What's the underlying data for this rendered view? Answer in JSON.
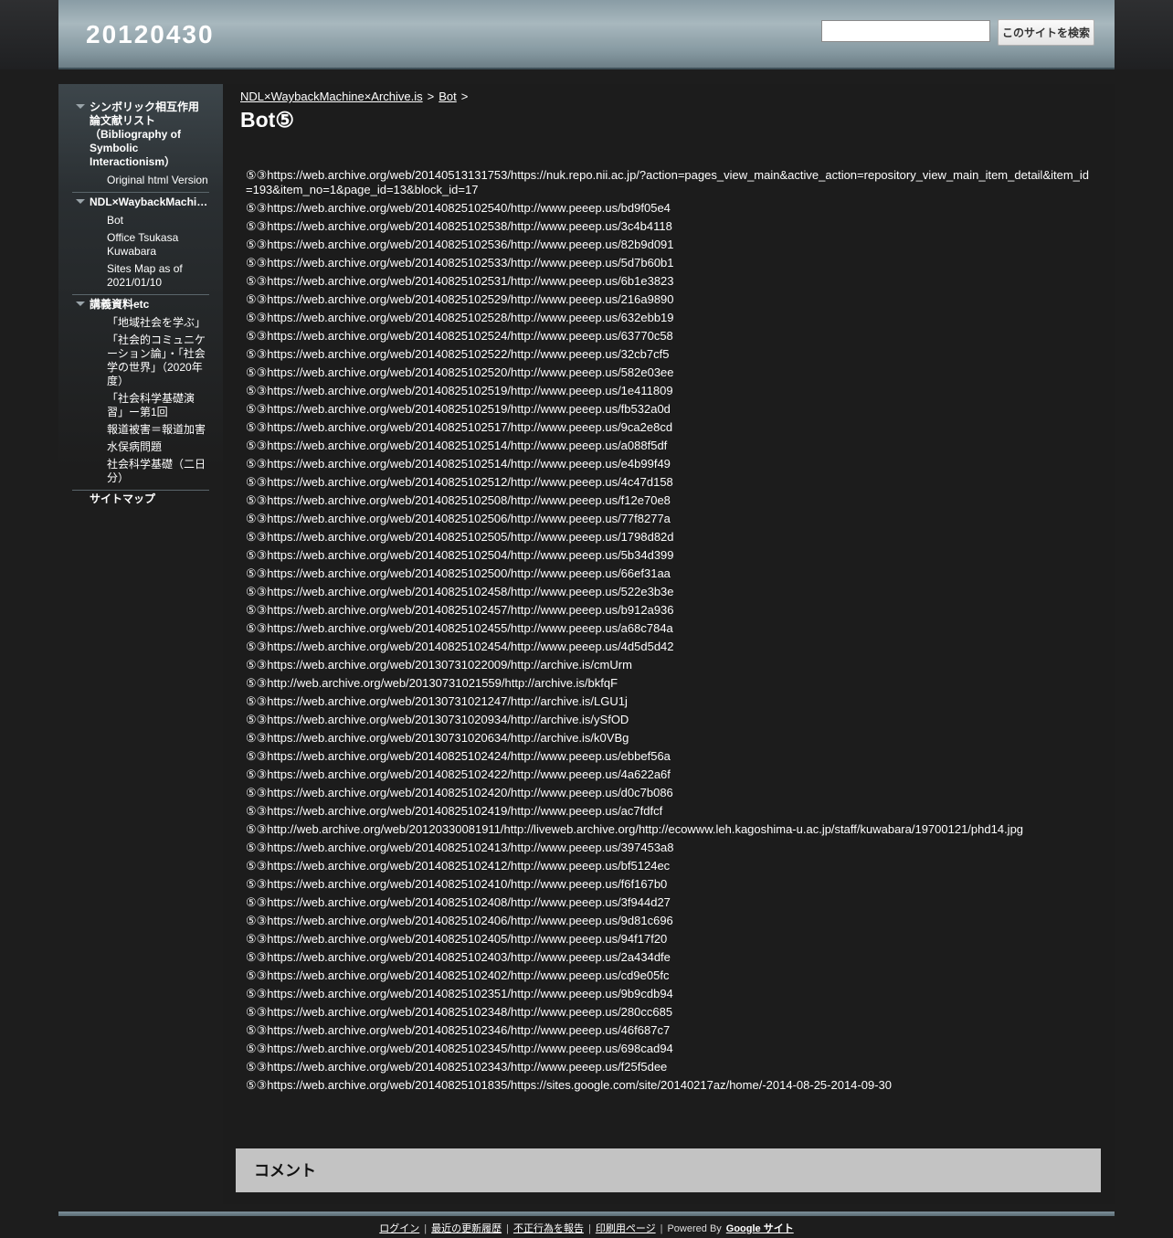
{
  "header": {
    "site_title": "20120430",
    "search_placeholder": "",
    "search_button": "このサイトを検索"
  },
  "sidebar": {
    "groups": [
      {
        "label": "シンボリック相互作用論文献リスト（Bibliography of Symbolic Interactionism）",
        "children": [
          "Original html Version"
        ]
      },
      {
        "label": "NDL×WaybackMachine×Archive.is",
        "children": [
          "Bot",
          "Office Tsukasa Kuwabara",
          "Sites Map as of 2021/01/10"
        ]
      },
      {
        "label": "講義資料etc",
        "children": [
          "「地域社会を学ぶ」",
          "「社会的コミュニケーション論」・「社会学の世界」（2020年度）",
          "「社会科学基礎演習」ー第1回",
          "報道被害＝報道加害",
          "水俣病問題",
          "社会科学基礎（二日分）"
        ]
      }
    ],
    "sitemap": "サイトマップ"
  },
  "breadcrumb": {
    "items": [
      "NDL×WaybackMachine×Archive.is",
      "Bot"
    ],
    "separator": ">"
  },
  "page_title": "Bot⑤",
  "links": [
    "⑤③https://web.archive.org/web/20140513131753/https://nuk.repo.nii.ac.jp/?action=pages_view_main&active_action=repository_view_main_item_detail&item_id=193&item_no=1&page_id=13&block_id=17",
    "⑤③https://web.archive.org/web/20140825102540/http://www.peeep.us/bd9f05e4",
    "⑤③https://web.archive.org/web/20140825102538/http://www.peeep.us/3c4b4118",
    "⑤③https://web.archive.org/web/20140825102536/http://www.peeep.us/82b9d091",
    "⑤③https://web.archive.org/web/20140825102533/http://www.peeep.us/5d7b60b1",
    "⑤③https://web.archive.org/web/20140825102531/http://www.peeep.us/6b1e3823",
    "⑤③https://web.archive.org/web/20140825102529/http://www.peeep.us/216a9890",
    "⑤③https://web.archive.org/web/20140825102528/http://www.peeep.us/632ebb19",
    "⑤③https://web.archive.org/web/20140825102524/http://www.peeep.us/63770c58",
    "⑤③https://web.archive.org/web/20140825102522/http://www.peeep.us/32cb7cf5",
    "⑤③https://web.archive.org/web/20140825102520/http://www.peeep.us/582e03ee",
    "⑤③https://web.archive.org/web/20140825102519/http://www.peeep.us/1e411809",
    "⑤③https://web.archive.org/web/20140825102519/http://www.peeep.us/fb532a0d",
    "⑤③https://web.archive.org/web/20140825102517/http://www.peeep.us/9ca2e8cd",
    "⑤③https://web.archive.org/web/20140825102514/http://www.peeep.us/a088f5df",
    "⑤③https://web.archive.org/web/20140825102514/http://www.peeep.us/e4b99f49",
    "⑤③https://web.archive.org/web/20140825102512/http://www.peeep.us/4c47d158",
    "⑤③https://web.archive.org/web/20140825102508/http://www.peeep.us/f12e70e8",
    "⑤③https://web.archive.org/web/20140825102506/http://www.peeep.us/77f8277a",
    "⑤③https://web.archive.org/web/20140825102505/http://www.peeep.us/1798d82d",
    "⑤③https://web.archive.org/web/20140825102504/http://www.peeep.us/5b34d399",
    "⑤③https://web.archive.org/web/20140825102500/http://www.peeep.us/66ef31aa",
    "⑤③https://web.archive.org/web/20140825102458/http://www.peeep.us/522e3b3e",
    "⑤③https://web.archive.org/web/20140825102457/http://www.peeep.us/b912a936",
    "⑤③https://web.archive.org/web/20140825102455/http://www.peeep.us/a68c784a",
    "⑤③https://web.archive.org/web/20140825102454/http://www.peeep.us/4d5d5d42",
    "⑤③https://web.archive.org/web/20130731022009/http://archive.is/cmUrm",
    "⑤③http://web.archive.org/web/20130731021559/http://archive.is/bkfqF",
    "⑤③https://web.archive.org/web/20130731021247/http://archive.is/LGU1j",
    "⑤③https://web.archive.org/web/20130731020934/http://archive.is/ySfOD",
    "⑤③https://web.archive.org/web/20130731020634/http://archive.is/k0VBg",
    "⑤③https://web.archive.org/web/20140825102424/http://www.peeep.us/ebbef56a",
    "⑤③https://web.archive.org/web/20140825102422/http://www.peeep.us/4a622a6f",
    "⑤③https://web.archive.org/web/20140825102420/http://www.peeep.us/d0c7b086",
    "⑤③https://web.archive.org/web/20140825102419/http://www.peeep.us/ac7fdfcf",
    "⑤③http://web.archive.org/web/20120330081911/http://liveweb.archive.org/http://ecowww.leh.kagoshima-u.ac.jp/staff/kuwabara/19700121/phd14.jpg",
    "⑤③https://web.archive.org/web/20140825102413/http://www.peeep.us/397453a8",
    "⑤③https://web.archive.org/web/20140825102412/http://www.peeep.us/bf5124ec",
    "⑤③https://web.archive.org/web/20140825102410/http://www.peeep.us/f6f167b0",
    "⑤③https://web.archive.org/web/20140825102408/http://www.peeep.us/3f944d27",
    "⑤③https://web.archive.org/web/20140825102406/http://www.peeep.us/9d81c696",
    "⑤③https://web.archive.org/web/20140825102405/http://www.peeep.us/94f17f20",
    "⑤③https://web.archive.org/web/20140825102403/http://www.peeep.us/2a434dfe",
    "⑤③https://web.archive.org/web/20140825102402/http://www.peeep.us/cd9e05fc",
    "⑤③https://web.archive.org/web/20140825102351/http://www.peeep.us/9b9cdb94",
    "⑤③https://web.archive.org/web/20140825102348/http://www.peeep.us/280cc685",
    "⑤③https://web.archive.org/web/20140825102346/http://www.peeep.us/46f687c7",
    "⑤③https://web.archive.org/web/20140825102345/http://www.peeep.us/698cad94",
    "⑤③https://web.archive.org/web/20140825102343/http://www.peeep.us/f25f5dee",
    "⑤③https://web.archive.org/web/20140825101835/https://sites.google.com/site/20140217az/home/-2014-08-25-2014-09-30"
  ],
  "comments": {
    "title": "コメント"
  },
  "footer": {
    "links": [
      "ログイン",
      "最近の更新履歴",
      "不正行為を報告",
      "印刷用ページ"
    ],
    "powered_by": "Powered By",
    "brand": "Google サイト"
  },
  "colors": {
    "page_background": "#1d1d1d",
    "header_gradient_mid": "#a8b8be",
    "comment_box": "#c3c3c3",
    "text": "#ffffff"
  }
}
